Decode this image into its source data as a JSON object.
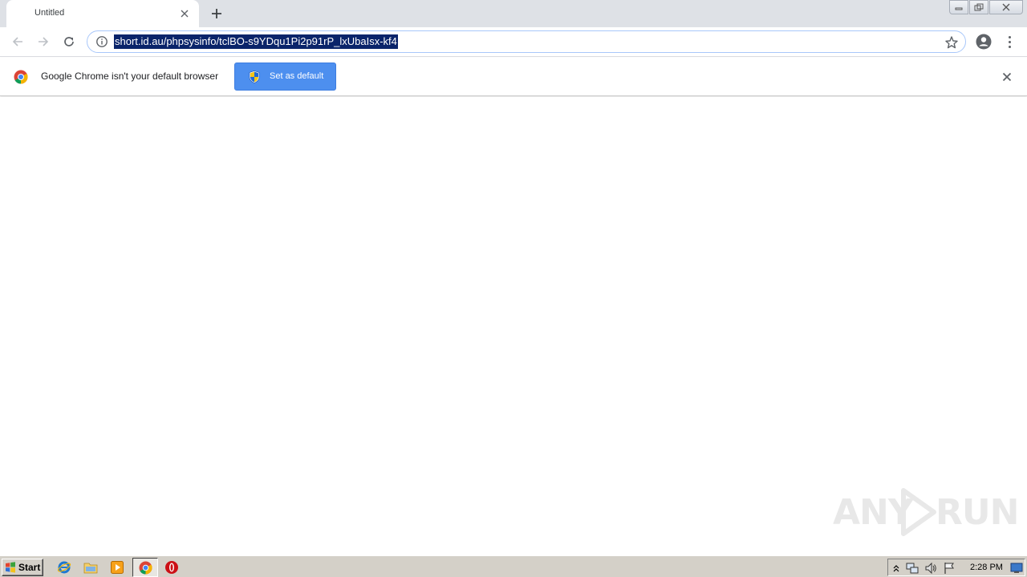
{
  "browser": {
    "tab": {
      "title": "Untitled"
    },
    "address_bar": {
      "url": "short.id.au/phpsysinfo/tclBO-s9YDqu1Pi2p91rP_lxUbaIsx-kf4"
    }
  },
  "infobar": {
    "message": "Google Chrome isn't your default browser",
    "button_label": "Set as default"
  },
  "watermark": {
    "text_left": "ANY",
    "text_right": "RUN"
  },
  "taskbar": {
    "start_label": "Start",
    "clock": "2:28 PM"
  },
  "colors": {
    "accent_button": "#4d8fef",
    "url_selection": "#0a246a",
    "tab_strip": "#dee1e6",
    "taskbar": "#d4d0c8"
  },
  "icons": [
    "back-arrow-icon",
    "forward-arrow-icon",
    "reload-icon",
    "info-icon",
    "star-icon",
    "profile-icon",
    "menu-icon",
    "chrome-logo-icon",
    "shield-icon",
    "close-icon",
    "windows-flag-icon",
    "ie-icon",
    "folder-icon",
    "media-player-icon",
    "chrome-icon",
    "opera-icon"
  ]
}
